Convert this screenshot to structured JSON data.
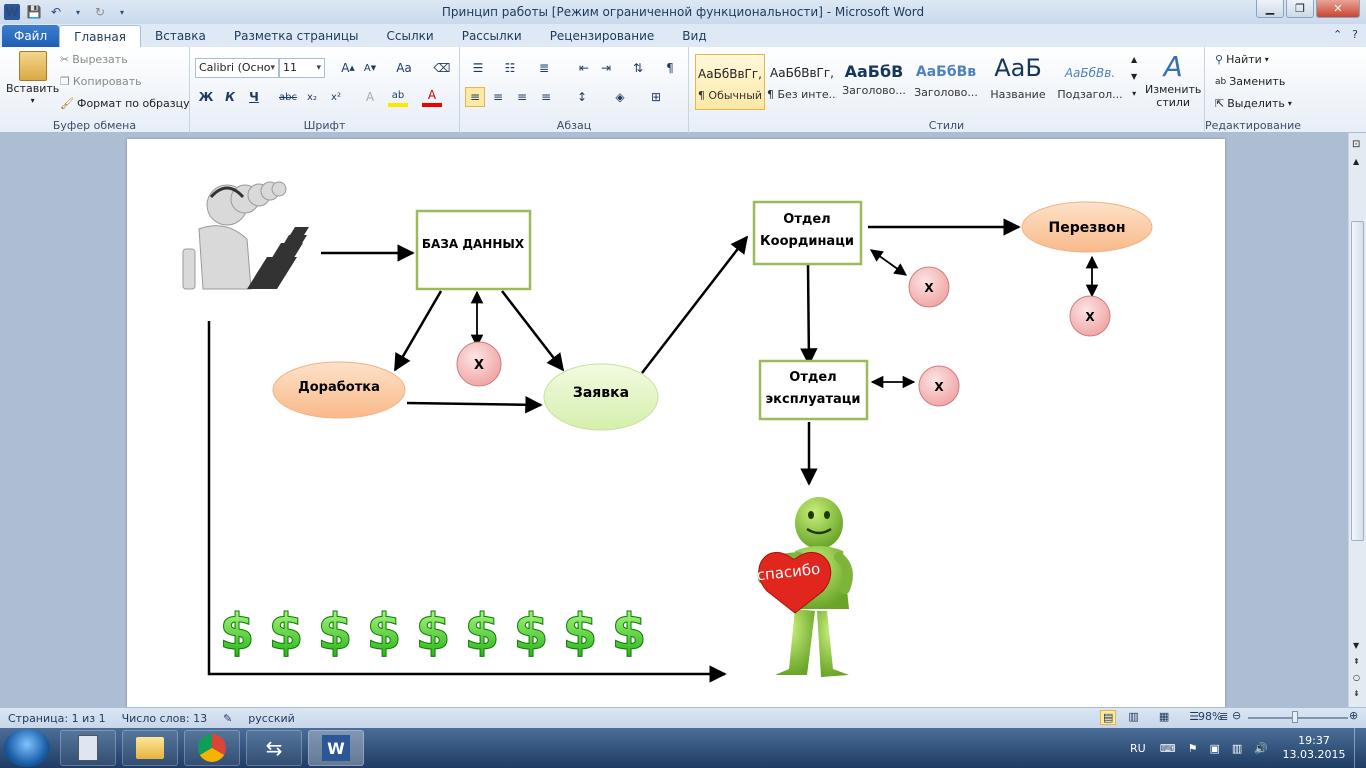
{
  "window": {
    "title": "Принцип работы [Режим ограниченной функциональности]  -  Microsoft Word"
  },
  "tabs": [
    "Файл",
    "Главная",
    "Вставка",
    "Разметка страницы",
    "Ссылки",
    "Рассылки",
    "Рецензирование",
    "Вид"
  ],
  "clipboard": {
    "paste": "Вставить",
    "cut": "Вырезать",
    "copy": "Копировать",
    "format_painter": "Формат по образцу",
    "label": "Буфер обмена"
  },
  "font": {
    "name": "Calibri (Осно",
    "size": "11",
    "bold": "Ж",
    "italic": "К",
    "underline": "Ч",
    "label": "Шрифт"
  },
  "paragraph": {
    "label": "Абзац"
  },
  "styles": {
    "items": [
      {
        "preview": "АаБбВвГг,",
        "name": "¶ Обычный"
      },
      {
        "preview": "АаБбВвГг,",
        "name": "¶ Без инте..."
      },
      {
        "preview": "АаБбВ",
        "name": "Заголово..."
      },
      {
        "preview": "АаБбВв",
        "name": "Заголово..."
      },
      {
        "preview": "АаБ",
        "name": "Название"
      },
      {
        "preview": "АаБбВв.",
        "name": "Подзагол..."
      }
    ],
    "change_styles_1": "Изменить",
    "change_styles_2": "стили",
    "label": "Стили"
  },
  "editing": {
    "find": "Найти",
    "replace": "Заменить",
    "select": "Выделить",
    "label": "Редактирование"
  },
  "diagram": {
    "database": "БАЗА ДАННЫХ",
    "coord_1": "Отдел",
    "coord_2": "Координаци",
    "recall": "Перезвон",
    "rework": "Доработка",
    "request": "Заявка",
    "ops_1": "Отдел",
    "ops_2": "эксплуатаци",
    "x_mark": "Х",
    "thanks": "спасибо",
    "dollar": "$"
  },
  "status": {
    "page": "Страница: 1 из 1",
    "words": "Число слов: 13",
    "language": "русский",
    "zoom": "98%"
  },
  "tray": {
    "lang": "RU",
    "time": "19:37",
    "date": "13.03.2015"
  }
}
